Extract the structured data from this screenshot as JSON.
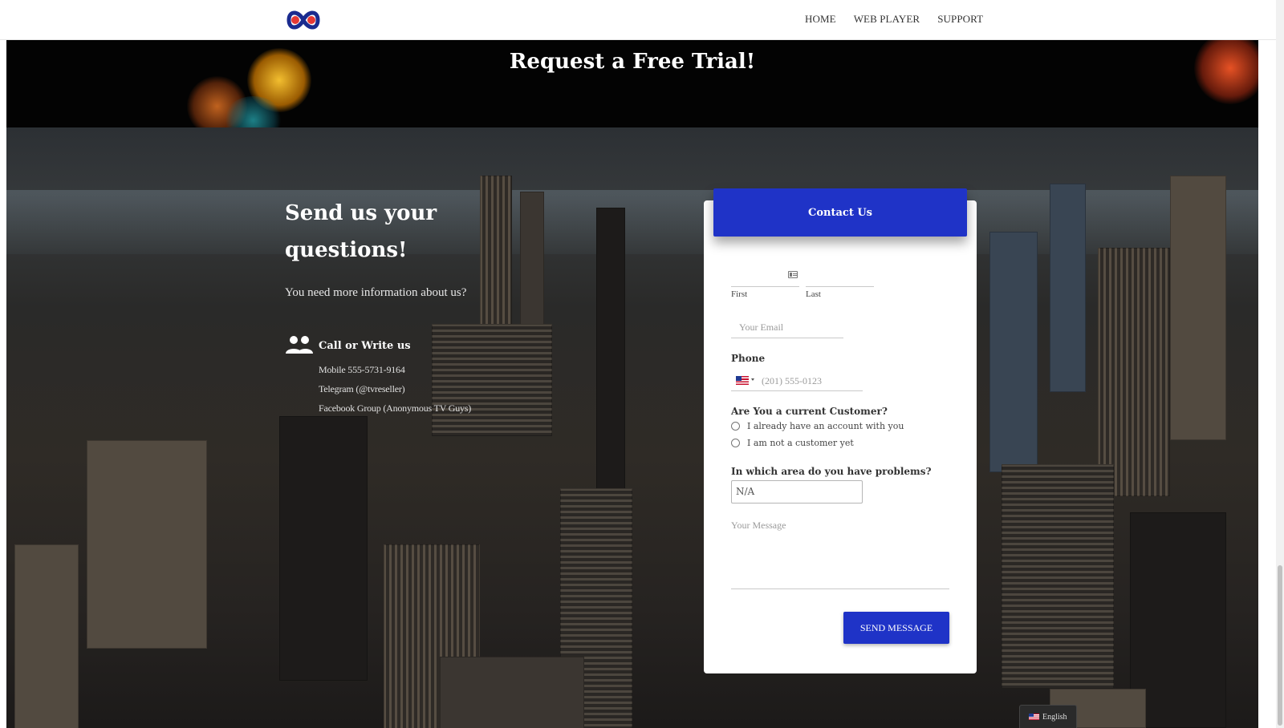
{
  "nav": {
    "items": [
      "HOME",
      "WEB PLAYER",
      "SUPPORT"
    ]
  },
  "hero": {
    "title": "Request a Free Trial!"
  },
  "info": {
    "heading": "Send us your questions!",
    "subtitle": "You need more information about us?",
    "contact_title": "Call or Write us",
    "lines": [
      "Mobile 555-5731-9164",
      "Telegram (@tvreseller)",
      "Facebook Group (Anonymous TV Guys)"
    ]
  },
  "form": {
    "header": "Contact Us",
    "first_label": "First",
    "last_label": "Last",
    "email_placeholder": "Your Email",
    "phone_label": "Phone",
    "phone_placeholder": "(201) 555-0123",
    "customer_question": "Are You a current Customer?",
    "customer_options": [
      "I already have an account with you",
      "I am not a customer yet"
    ],
    "area_question": "In which area do you have problems?",
    "area_value": "N/A",
    "message_placeholder": "Your Message",
    "send_label": "SEND MESSAGE"
  },
  "language": {
    "label": "English"
  },
  "colors": {
    "accent": "#1f33c7",
    "nav_bg": "#ffffff",
    "hero_bg": "#030303"
  },
  "icons": [
    "logo-icon",
    "users-icon",
    "id-card-icon",
    "us-flag-icon",
    "caret-down-icon"
  ]
}
